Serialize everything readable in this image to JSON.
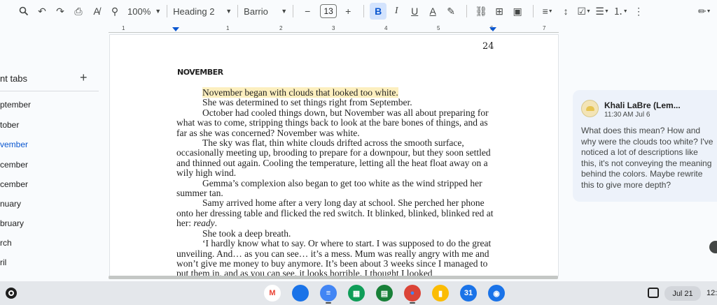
{
  "toolbar": {
    "zoom": "100%",
    "style": "Heading 2",
    "font": "Barrio",
    "font_size": "13",
    "icons": [
      "search-icon",
      "undo-icon",
      "redo-icon",
      "print-icon",
      "spellcheck-icon",
      "paint-format-icon",
      "bold-icon",
      "italic-icon",
      "underline-icon",
      "text-color-icon",
      "highlight-icon",
      "link-icon",
      "comment-icon",
      "image-icon",
      "align-icon",
      "line-spacing-icon",
      "checklist-icon",
      "bulleted-list-icon",
      "numbered-list-icon",
      "more-icon",
      "edit-mode-icon"
    ]
  },
  "ruler": {
    "numbers": [
      "1",
      "1",
      "2",
      "3",
      "4",
      "5",
      "6",
      "7"
    ]
  },
  "tabs_panel": {
    "title": "nt tabs",
    "add_icon": "+",
    "items": [
      {
        "label": "ptember",
        "active": false
      },
      {
        "label": "tober",
        "active": false
      },
      {
        "label": "vember",
        "active": true
      },
      {
        "label": "cember",
        "active": false
      },
      {
        "label": "cember",
        "active": false
      },
      {
        "label": "nuary",
        "active": false
      },
      {
        "label": "bruary",
        "active": false
      },
      {
        "label": "rch",
        "active": false
      },
      {
        "label": "ril",
        "active": false
      }
    ]
  },
  "page": {
    "number": "24",
    "chapter_title": "NOVEMBER",
    "highlighted_sentence": "November began with clouds that looked too white.",
    "paragraphs": [
      {
        "text": "She was determined to set things right from September.",
        "indent": true
      },
      {
        "text": "October had cooled things down, but November was all about preparing for what was to come, stripping things back to look at the bare bones of things, and as far as she was concerned? November was white.",
        "indent": true
      },
      {
        "text": "The sky was flat, thin white clouds drifted across the smooth surface, occasionally meeting up, brooding to prepare for a downpour, but they soon settled and thinned out again. Cooling the temperature, letting all the heat float away on a wily high wind.",
        "indent": true
      },
      {
        "text": "Gemma’s complexion also  began to get too white as the wind stripped her summer tan.",
        "indent": true
      },
      {
        "text": "Samy arrived home after a very long day at school. She perched her phone onto her dressing table and flicked the red switch. It blinked, blinked, blinked red at her:",
        "indent": true,
        "italic_tail": "ready",
        "tail_end": "."
      },
      {
        "text": "She took a deep breath.",
        "indent": true
      },
      {
        "text": "‘I hardly know what to say. Or where to start. I was supposed to do the great unveiling. And… as you can see… it’s a mess. Mum was really angry with me and won’t give me money to buy anymore. It’s been about 3 weeks since I managed to put them in, and as you can see, it looks horrible. I thought I looked",
        "indent": true
      }
    ]
  },
  "comment": {
    "author": "Khali LaBre (Lem...",
    "time": "11:30 AM Jul 6",
    "text": "What does this mean? How and why were the clouds too white? I've noticed a lot of descriptions like this, it's not conveying the meaning behind the colors. Maybe rewrite this to give more depth?"
  },
  "shelf": {
    "apps": [
      {
        "name": "gmail-icon",
        "glyph": "M",
        "color": "#ffffff",
        "fg": "#ea4335"
      },
      {
        "name": "files-icon",
        "glyph": "",
        "color": "#1a73e8",
        "fg": "#ffffff"
      },
      {
        "name": "docs-icon",
        "glyph": "≡",
        "color": "#4285f4",
        "fg": "#ffffff"
      },
      {
        "name": "sheets-icon",
        "glyph": "▦",
        "color": "#0f9d58",
        "fg": "#ffffff"
      },
      {
        "name": "sheets2-icon",
        "glyph": "▤",
        "color": "#188038",
        "fg": "#ffffff"
      },
      {
        "name": "chrome-icon",
        "glyph": "●",
        "color": "#db4437",
        "fg": "#4285f4"
      },
      {
        "name": "keep-icon",
        "glyph": "▮",
        "color": "#fbbc04",
        "fg": "#ffffff"
      },
      {
        "name": "calendar-icon",
        "glyph": "31",
        "color": "#1a73e8",
        "fg": "#ffffff"
      },
      {
        "name": "camera-icon",
        "glyph": "◉",
        "color": "#1a73e8",
        "fg": "#ffffff"
      }
    ],
    "date": "Jul 21",
    "time": "12:"
  }
}
